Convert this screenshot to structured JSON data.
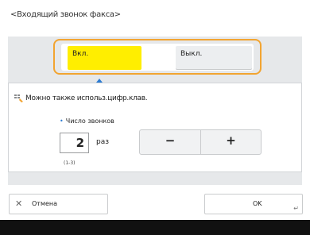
{
  "dialog": {
    "title": "<Входящий звонок факса>"
  },
  "toggle": {
    "on_label": "Вкл.",
    "off_label": "Выкл.",
    "selected": "on"
  },
  "settings": {
    "hint": "Можно также использ.цифр.клав.",
    "ring_count_label": "Число звонков",
    "ring_count_value": "2",
    "unit": "раз",
    "range": "(1-3)",
    "minus_label": "−",
    "plus_label": "+"
  },
  "footer": {
    "cancel_label": "Отмена",
    "ok_label": "OK"
  },
  "colors": {
    "accent_selected": "#ffee00",
    "focus_frame": "#f2a431",
    "pointer": "#2b7bd2"
  }
}
